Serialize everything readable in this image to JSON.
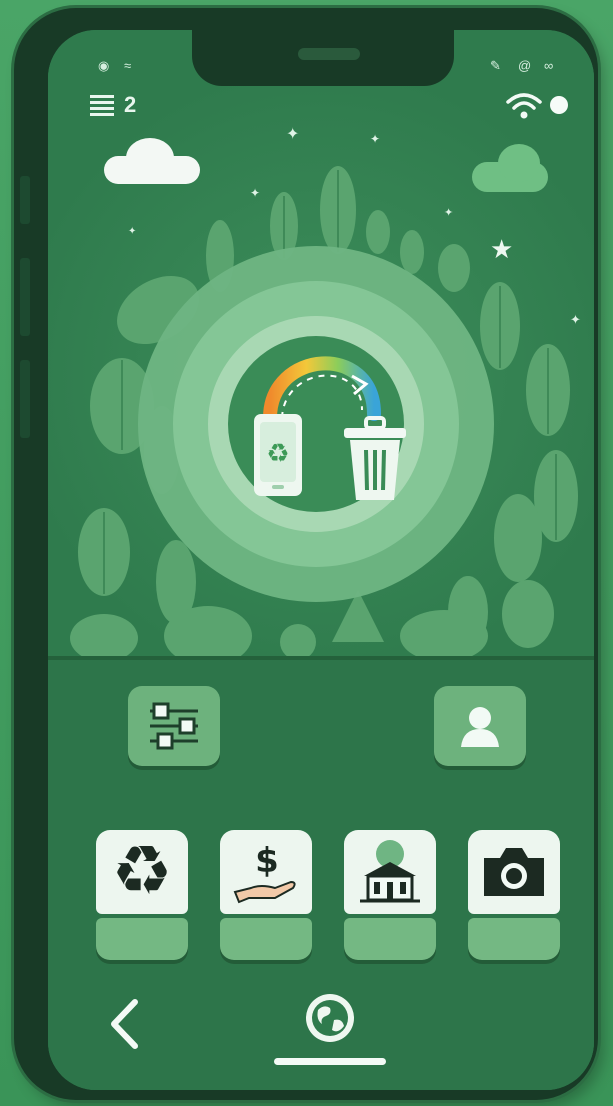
{
  "status_bar": {
    "notification_count": "2",
    "left_icons": [
      "eye-icon",
      "signal-icon"
    ],
    "right_icons": [
      "pen-icon",
      "at-icon",
      "link-icon",
      "wifi-icon",
      "battery-dot-icon"
    ]
  },
  "hero": {
    "illustration": "phone-to-trash-recycling-transfer",
    "colors": {
      "accent": "#3a8c57",
      "ring": "#84c696",
      "leaf": "#6fb583"
    }
  },
  "quick_actions": [
    {
      "name": "filter-settings",
      "icon": "sliders-icon"
    },
    {
      "name": "profile",
      "icon": "user-icon"
    }
  ],
  "tiles": [
    {
      "name": "recycle",
      "icon": "recycle-icon"
    },
    {
      "name": "rewards",
      "icon": "dollar-hand-icon"
    },
    {
      "name": "locations",
      "icon": "building-icon"
    },
    {
      "name": "scan",
      "icon": "camera-icon"
    }
  ],
  "nav": {
    "back_icon": "chevron-left-icon",
    "home_icon": "globe-icon"
  }
}
